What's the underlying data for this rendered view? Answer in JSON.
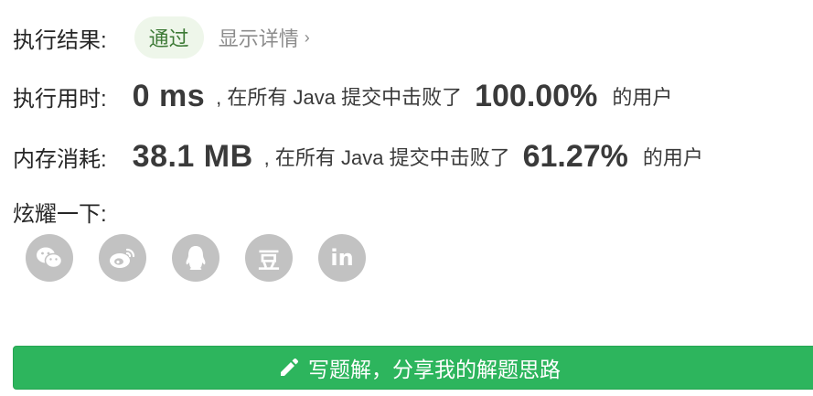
{
  "result": {
    "label": "执行结果:",
    "status": "通过",
    "details_link": "显示详情"
  },
  "runtime": {
    "label": "执行用时:",
    "value": "0 ms",
    "prefix": ", 在所有 Java 提交中击败了",
    "percent": "100.00%",
    "suffix": "的用户"
  },
  "memory": {
    "label": "内存消耗:",
    "value": "38.1 MB",
    "prefix": ", 在所有 Java 提交中击败了",
    "percent": "61.27%",
    "suffix": "的用户"
  },
  "share": {
    "label": "炫耀一下:",
    "icons": [
      "wechat-icon",
      "weibo-icon",
      "qq-icon",
      "douban-icon",
      "linkedin-icon"
    ],
    "douban_glyph": "豆",
    "linkedin_glyph": "in"
  },
  "write_solution": {
    "label": "写题解，分享我的解题思路"
  },
  "colors": {
    "accent_green": "#2db55d",
    "badge_bg": "#eef6ea",
    "badge_text": "#3d7a36",
    "icon_gray": "#c2c2c2"
  }
}
